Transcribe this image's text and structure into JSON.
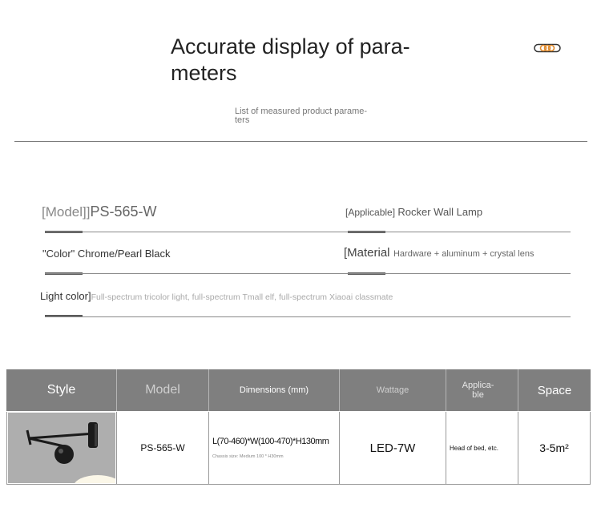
{
  "header": {
    "title": "Accurate display of para- meters",
    "subtitle": "List of measured product parame- ters"
  },
  "params": {
    "model_label": "[Model]]",
    "model_value": "PS-565-W",
    "applicable_label": "[Applicable]",
    "applicable_value": "Rocker Wall Lamp",
    "color_label": "\"Color\"",
    "color_value": "Chrome/Pearl Black",
    "material_label": "[Material",
    "material_value": "Hardware + aluminum + crystal lens",
    "light_label": "Light color]",
    "light_value": "Full-spectrum tricolor light, full-spectrum Tmall elf, full-spectrum Xiaoai classmate"
  },
  "table": {
    "headers": {
      "style": "Style",
      "model": "Model",
      "dimensions": "Dimensions (mm)",
      "wattage": "Wattage",
      "applicable": "Applica- ble",
      "space": "Space"
    },
    "row": {
      "model": "PS-565-W",
      "dimensions": "L(70-460)*W(100-470)*H130mm",
      "dimensions_note": "Chassis size: Medium 100 * H30mm",
      "wattage": "LED-7W",
      "applicable": "Head of bed, etc.",
      "space": "3-5m²"
    }
  },
  "colors": {
    "header_bg": "#7f7f7f",
    "logo_accent": "#e08a2c"
  },
  "icons": {
    "logo": "ring-logo-icon",
    "product": "swing-arm-wall-lamp-photo"
  }
}
